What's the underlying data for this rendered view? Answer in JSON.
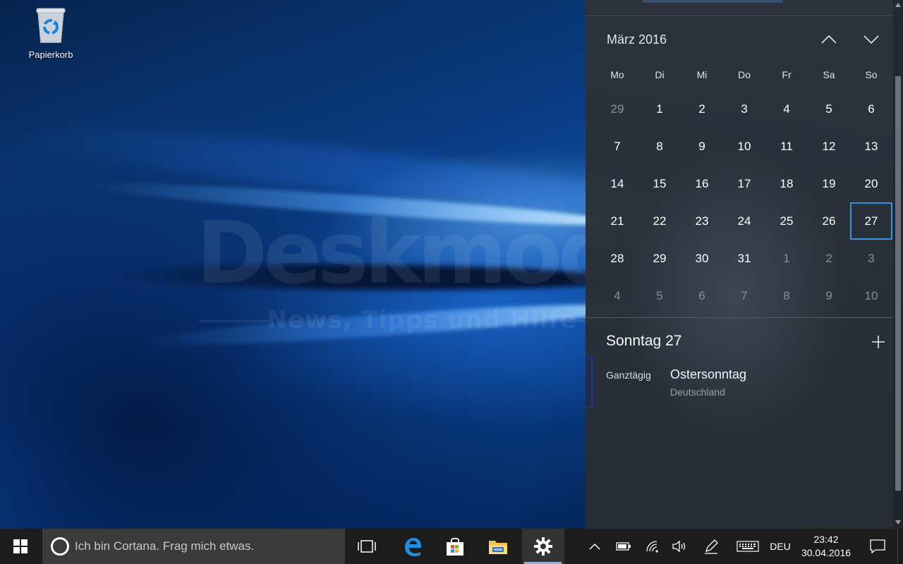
{
  "desktop": {
    "icons": [
      {
        "label": "Papierkorb",
        "icon": "recycle-bin-icon"
      }
    ],
    "watermark": {
      "title": "Deskmodder.de",
      "subtitle": "News, Tipps und Hilfe"
    }
  },
  "calendar": {
    "month_title": "März 2016",
    "nav": {
      "prev_icon": "chevron-up-icon",
      "next_icon": "chevron-down-icon"
    },
    "weekdays": [
      "Mo",
      "Di",
      "Mi",
      "Do",
      "Fr",
      "Sa",
      "So"
    ],
    "weeks": [
      [
        "29",
        "1",
        "2",
        "3",
        "4",
        "5",
        "6"
      ],
      [
        "7",
        "8",
        "9",
        "10",
        "11",
        "12",
        "13"
      ],
      [
        "14",
        "15",
        "16",
        "17",
        "18",
        "19",
        "20"
      ],
      [
        "21",
        "22",
        "23",
        "24",
        "25",
        "26",
        "27"
      ],
      [
        "28",
        "29",
        "30",
        "31",
        "1",
        "2",
        "3"
      ],
      [
        "4",
        "5",
        "6",
        "7",
        "8",
        "9",
        "10"
      ]
    ],
    "today": "27"
  },
  "agenda": {
    "title": "Sonntag 27",
    "add_icon": "plus-icon",
    "events": [
      {
        "time": "Ganztägig",
        "title": "Ostersonntag",
        "subtitle": "Deutschland"
      }
    ]
  },
  "taskbar": {
    "start_icon": "windows-logo-icon",
    "search_placeholder": "Ich bin Cortana. Frag mich etwas.",
    "apps": [
      "task-view-icon",
      "edge-icon",
      "store-icon",
      "file-explorer-icon",
      "settings-icon"
    ],
    "active_app": "settings-icon",
    "tray": {
      "icons": [
        "chevron-up-icon",
        "battery-icon",
        "wifi-icon",
        "volume-icon",
        "pen-icon",
        "keyboard-icon"
      ],
      "language": "DEU",
      "time": "23:42",
      "date": "30.04.2016",
      "notification_icon": "action-center-icon"
    }
  },
  "colors": {
    "accent": "#3d8fe0",
    "flyout_bg": "#2c323a",
    "taskbar_bg": "#1c1c1c",
    "search_bg": "#3a3a3a"
  }
}
